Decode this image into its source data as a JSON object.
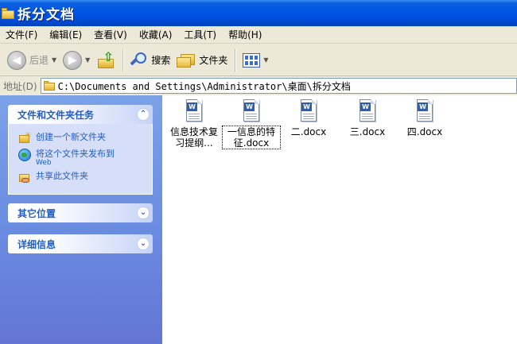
{
  "window": {
    "title": "拆分文档"
  },
  "menu": {
    "items": [
      "文件(F)",
      "编辑(E)",
      "查看(V)",
      "收藏(A)",
      "工具(T)",
      "帮助(H)"
    ]
  },
  "toolbar": {
    "back_label": "后退",
    "search_label": "搜索",
    "folders_label": "文件夹"
  },
  "address": {
    "label": "地址(D)",
    "path": "C:\\Documents and Settings\\Administrator\\桌面\\拆分文档"
  },
  "taskpane": {
    "tasks_panel": {
      "title": "文件和文件夹任务",
      "items": [
        {
          "label": "创建一个新文件夹",
          "sub": ""
        },
        {
          "label": "将这个文件夹发布到",
          "sub": "Web"
        },
        {
          "label": "共享此文件夹",
          "sub": ""
        }
      ]
    },
    "other_places_title": "其它位置",
    "details_title": "详细信息"
  },
  "files": [
    {
      "name": "信息技术复习提纲..."
    },
    {
      "name": "一信息的特征.docx"
    },
    {
      "name": "二.docx"
    },
    {
      "name": "三.docx"
    },
    {
      "name": "四.docx"
    }
  ],
  "icons": {
    "doc_glyph": "W",
    "collapse_glyph": "⌃",
    "expand_glyph": "⌄"
  },
  "colors": {
    "titlebar": "#0054e3",
    "task_link": "#215dc6",
    "pane_bg": "#6b8ee1"
  }
}
